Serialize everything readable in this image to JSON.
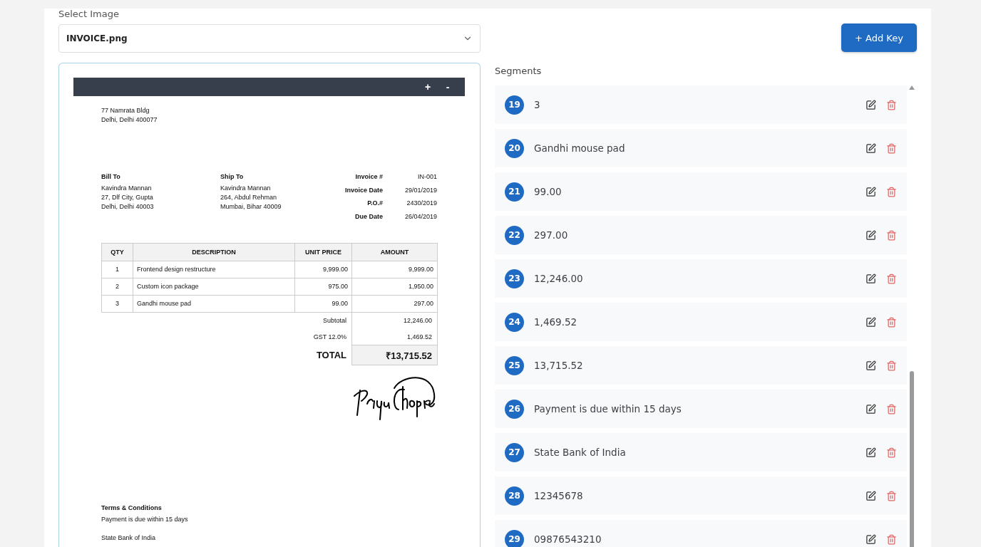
{
  "select_image": {
    "label": "Select Image",
    "value": "INVOICE.png"
  },
  "preview": {
    "zoom_in": "+",
    "zoom_out": "-",
    "from_address": [
      "77 Namrata Bldg",
      "Delhi, Delhi 400077"
    ],
    "parties": [
      {
        "heading": "Bill To",
        "lines": [
          "Kavindra Mannan",
          "27, Dlf City, Gupta",
          "Delhi, Delhi 40003"
        ]
      },
      {
        "heading": "Ship To",
        "lines": [
          "Kavindra Mannan",
          "264, Abdul Rehman",
          "Mumbai, Bihar 40009"
        ]
      }
    ],
    "meta": [
      {
        "label": "Invoice #",
        "value": "IN-001"
      },
      {
        "label": "Invoice Date",
        "value": "29/01/2019"
      },
      {
        "label": "P.O.#",
        "value": "2430/2019"
      },
      {
        "label": "Due Date",
        "value": "26/04/2019"
      }
    ],
    "table": {
      "columns": [
        "QTY",
        "DESCRIPTION",
        "UNIT PRICE",
        "AMOUNT"
      ],
      "rows": [
        [
          "1",
          "Frontend design restructure",
          "9,999.00",
          "9,999.00"
        ],
        [
          "2",
          "Custom icon package",
          "975.00",
          "1,950.00"
        ],
        [
          "3",
          "Gandhi mouse pad",
          "99.00",
          "297.00"
        ]
      ]
    },
    "totals": [
      {
        "kind": "plain",
        "label": "Subtotal",
        "value": "12,246.00"
      },
      {
        "kind": "plain",
        "label": "GST 12.0%",
        "value": "1,469.52"
      },
      {
        "kind": "total",
        "label": "TOTAL",
        "value": "₹13,715.52"
      }
    ],
    "terms": {
      "heading": "Terms & Conditions",
      "paragraphs": [
        "Payment is due within 15 days",
        "State Bank of India"
      ]
    }
  },
  "add_key_button": "+ Add Key",
  "segments": {
    "title": "Segments",
    "items": [
      {
        "number": "19",
        "text": "3"
      },
      {
        "number": "20",
        "text": "Gandhi mouse pad"
      },
      {
        "number": "21",
        "text": "99.00"
      },
      {
        "number": "22",
        "text": "297.00"
      },
      {
        "number": "23",
        "text": "12,246.00"
      },
      {
        "number": "24",
        "text": "1,469.52"
      },
      {
        "number": "25",
        "text": "13,715.52"
      },
      {
        "number": "26",
        "text": "Payment is due within 15 days"
      },
      {
        "number": "27",
        "text": "State Bank of India"
      },
      {
        "number": "28",
        "text": "12345678"
      },
      {
        "number": "29",
        "text": "09876543210"
      }
    ]
  }
}
